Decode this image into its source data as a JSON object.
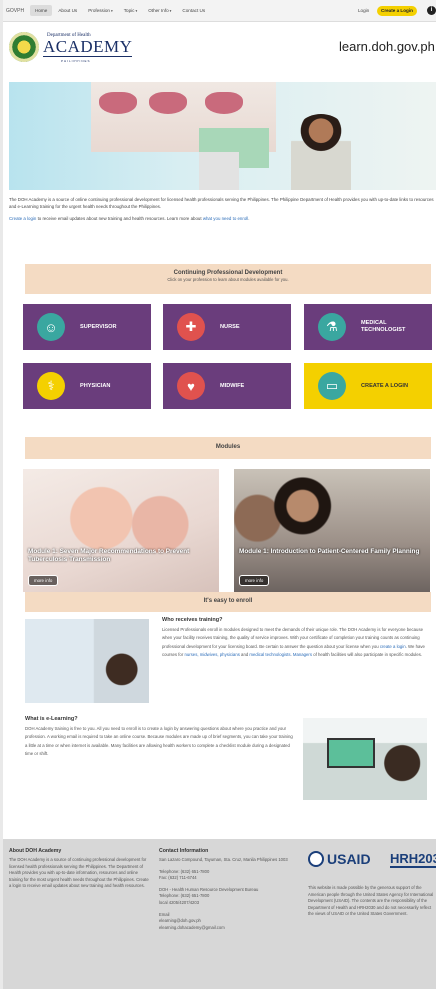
{
  "nav": {
    "brand": "GOVPH",
    "items": [
      {
        "label": "Home",
        "active": true
      },
      {
        "label": "About Us",
        "active": false
      },
      {
        "label": "Profession",
        "active": false,
        "dropdown": true
      },
      {
        "label": "Topic",
        "active": false,
        "dropdown": true
      },
      {
        "label": "Other Info",
        "active": false,
        "dropdown": true
      },
      {
        "label": "Contact Us",
        "active": false
      }
    ],
    "login": "Login",
    "create_login": "Create a Login",
    "info_icon": "info-icon"
  },
  "header": {
    "dept": "Department of Health",
    "academy": "ACADEMY",
    "tagline": "PHILIPPINES",
    "site_url": "learn.doh.gov.ph"
  },
  "intro": {
    "p1": "The DOH Academy is a source of online continuing professional development for licensed health professionals serving the Philippines. The Philippine Department of Health provides you with up-to-date links to resources and e-Learning training for the urgent health needs throughout the Philippines.",
    "p2_link1": "Create a login",
    "p2_mid": " to receive email updates about new training and health resources. Learn more about ",
    "p2_link2": "what you need to enroll",
    "p2_end": "."
  },
  "cpd": {
    "title": "Continuing Professional Development",
    "subtitle": "Click on your profession to learn about modules available for you.",
    "tiles": [
      {
        "label": "SUPERVISOR",
        "icon": "supervisor-icon",
        "color": "#3aa7a0"
      },
      {
        "label": "NURSE",
        "icon": "nurse-icon",
        "color": "#e0524e"
      },
      {
        "label": "MEDICAL TECHNOLOGIST",
        "icon": "test-tubes-icon",
        "color": "#3aa7a0"
      },
      {
        "label": "PHYSICIAN",
        "icon": "physician-icon",
        "color": "#f4d000"
      },
      {
        "label": "MIDWIFE",
        "icon": "midwife-icon",
        "color": "#e0524e"
      },
      {
        "label": "CREATE A LOGIN",
        "icon": "create-login-icon",
        "color": "#3aa7a0"
      }
    ]
  },
  "modules": {
    "title": "Modules",
    "cards": [
      {
        "title": "Module 1: Seven Major Recommendations to Prevent Tuberculosis Transmission",
        "button": "more info"
      },
      {
        "title": "Module 1: Introduction to Patient-Centered Family Planning",
        "button": "more info"
      }
    ]
  },
  "enroll": {
    "title": "It's easy to enroll",
    "who_title": "Who receives training?",
    "who_p1": "Licensed Professionals enroll in modules designed to meet the demands of their unique role. The DOH Academy is for everyone because when your facility receives training, the quality of service improves. With your certificate of completion your training counts as continuing professional development for your licensing board. Be certain to answer the question about your license when you ",
    "who_link1": "create a login",
    "who_p2": ". We have courses for ",
    "who_link2": "nurses, midwives, physicians",
    "who_p3": " and ",
    "who_link3": "medical technologists",
    "who_p4": ". ",
    "who_link4": "Managers",
    "who_p5": " of health facilities will also participate in specific modules.",
    "elearn_title": "What is e-Learning?",
    "elearn_p": "DOH Academy training is free to you. All you need to enroll is to create a login by answering questions about where you practice and your profession. A working email is required to take an online course. Because modules are made up of brief segments, you can take your training a little at a time or when internet is available. Many facilities are allowing health workers to complete a checklist module during a designated time or shift."
  },
  "footer": {
    "about_title": "About DOH Academy",
    "about_text": "The DOH Academy is a source of continuing professional development for licensed health professionals serving the Philippines. The Department of Health provides you with up-to-date information, resources and online training for the most urgent health needs throughout the Philippines. Create a login to receive email updates about new training and health resources.",
    "contact_title": "Contact Information",
    "address": "San Lazaro Compound, Tayuman, Sta. Cruz, Manila Philippines 1003",
    "telephone": "Telephone: (632) 651-7800",
    "fax": "Fax: (632) 711-6744",
    "hhrdb": "DOH - Health Human Resource Development Bureau",
    "hhrdb_tel": "Telephone: (632) 651-7800",
    "hhrdb_local": "local 4205/4207/4203",
    "email_label": "Email",
    "email1": "elearning@doh.gov.ph",
    "email2": "elearning.dohacademy@gmail.com",
    "usaid": "USAID",
    "hrh": "HRH2030",
    "disclaimer": "This website is made possible by the generous support of the American people through the United States Agency for International Development (USAID). The contents are the responsibility of the Department of Health and HRH2030 and do not necessarily reflect the views of USAID or the United States Government."
  }
}
